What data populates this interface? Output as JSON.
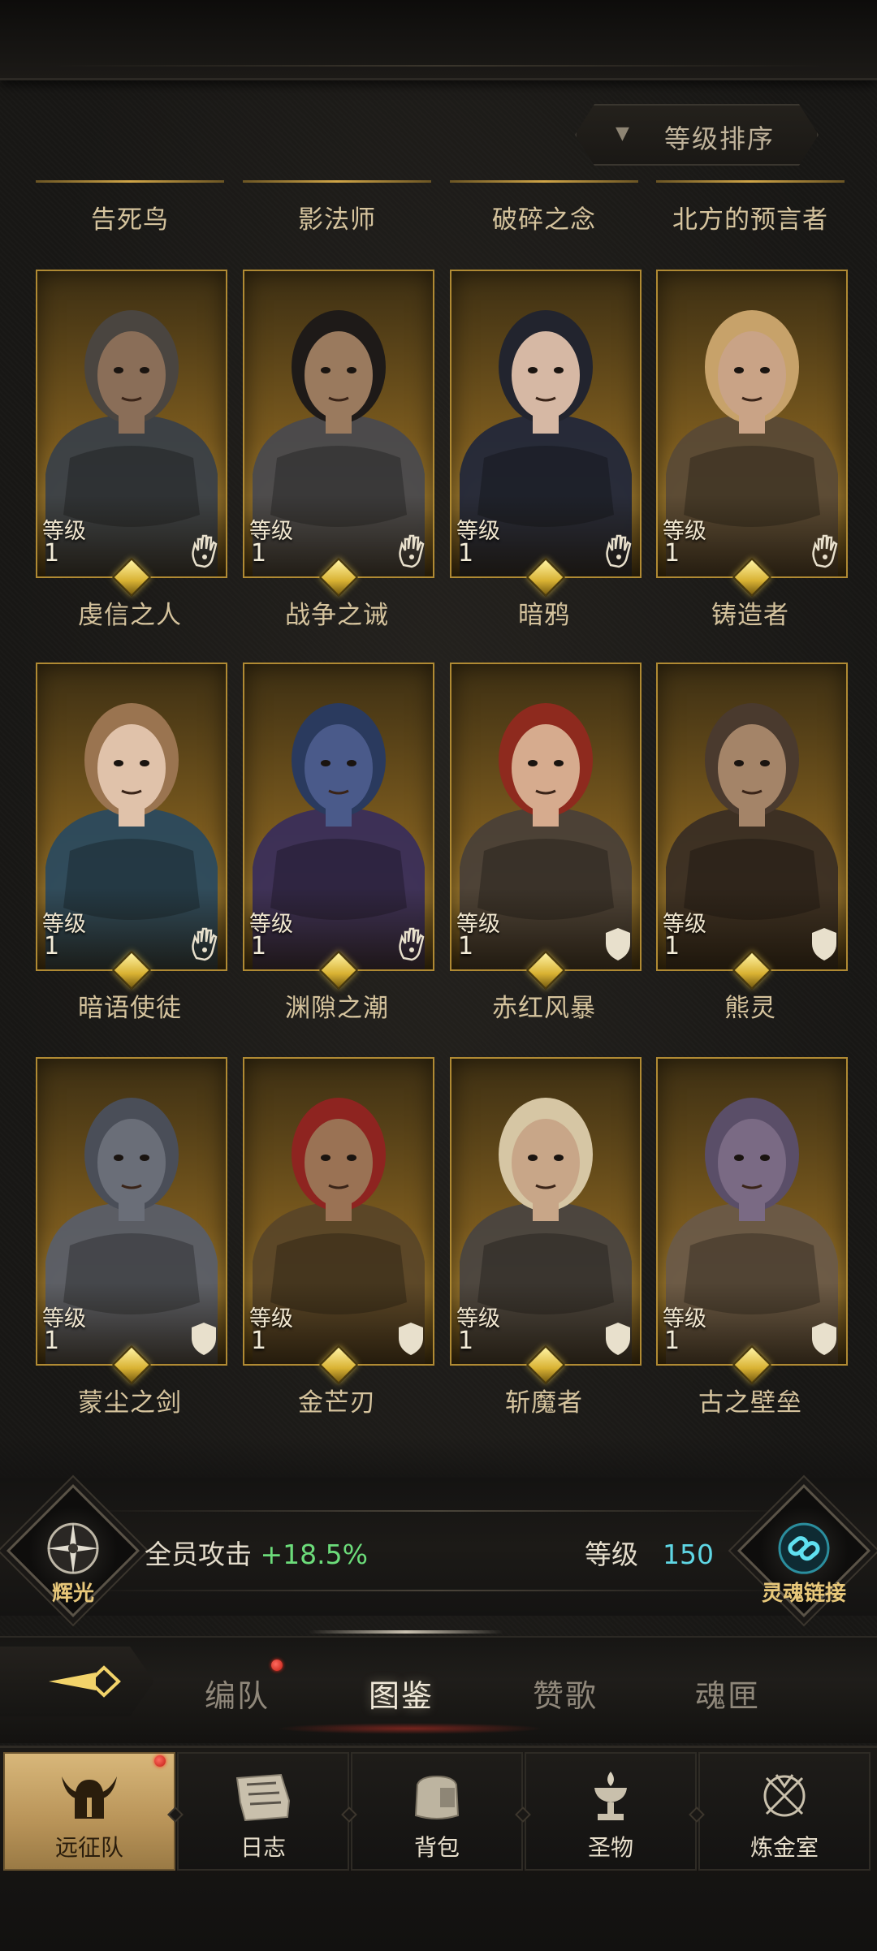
{
  "sort": {
    "label": "等级排序",
    "arrow_icon": "triangle-down-icon"
  },
  "top_row_names": [
    "告死鸟",
    "影法师",
    "破碎之念",
    "北方的预言者"
  ],
  "level_label": "等级",
  "heroes": [
    {
      "name": "虔信之人",
      "level": "1",
      "class_icon": "hand-icon",
      "palette": {
        "skin": "#8a6e58",
        "hair": "#4a4540",
        "armor": "#3a4048"
      }
    },
    {
      "name": "战争之诫",
      "level": "1",
      "class_icon": "hand-icon",
      "palette": {
        "skin": "#9a7a5e",
        "hair": "#1e1a18",
        "armor": "#4a4a4e"
      }
    },
    {
      "name": "暗鸦",
      "level": "1",
      "class_icon": "hand-icon",
      "palette": {
        "skin": "#d6b8a4",
        "hair": "#22242e",
        "armor": "#23283a"
      }
    },
    {
      "name": "铸造者",
      "level": "1",
      "class_icon": "hand-icon",
      "palette": {
        "skin": "#c9a386",
        "hair": "#c7a26a",
        "armor": "#5a4a36"
      }
    },
    {
      "name": "暗语使徒",
      "level": "1",
      "class_icon": "hand-icon",
      "palette": {
        "skin": "#e0c2aa",
        "hair": "#9a7450",
        "armor": "#2b4a5e"
      }
    },
    {
      "name": "渊隙之潮",
      "level": "1",
      "class_icon": "hand-icon",
      "palette": {
        "skin": "#4a5a8a",
        "hair": "#2a3a5e",
        "armor": "#3a2e5a"
      }
    },
    {
      "name": "赤红风暴",
      "level": "1",
      "class_icon": "shield-icon",
      "palette": {
        "skin": "#d6ab8e",
        "hair": "#8e2a1e",
        "armor": "#4a4038"
      }
    },
    {
      "name": "熊灵",
      "level": "1",
      "class_icon": "shield-icon",
      "palette": {
        "skin": "#a48468",
        "hair": "#4a3a2e",
        "armor": "#3a2e24"
      }
    },
    {
      "name": "蒙尘之剑",
      "level": "1",
      "class_icon": "shield-icon",
      "palette": {
        "skin": "#6a6e78",
        "hair": "#4a4e58",
        "armor": "#5a5e68"
      }
    },
    {
      "name": "金芒刃",
      "level": "1",
      "class_icon": "shield-icon",
      "palette": {
        "skin": "#9a7254",
        "hair": "#8e2420",
        "armor": "#5a4628"
      }
    },
    {
      "name": "斩魔者",
      "level": "1",
      "class_icon": "shield-icon",
      "palette": {
        "skin": "#c8a688",
        "hair": "#d6c6a4",
        "armor": "#4a4440"
      }
    },
    {
      "name": "古之壁垒",
      "level": "1",
      "class_icon": "shield-icon",
      "palette": {
        "skin": "#7a6a84",
        "hair": "#5a4e68",
        "armor": "#6a5a48"
      }
    }
  ],
  "status": {
    "radiance_label": "辉光",
    "radiance_icon": "compass-emblem-icon",
    "attack_label": "全员攻击",
    "attack_value": "+18.5%",
    "level_label": "等级",
    "level_value": "150",
    "soul_link_label": "灵魂链接",
    "soul_link_icon": "chain-link-icon",
    "colors": {
      "attack": "#6cdc7a",
      "level": "#5fd6e4",
      "gold": "#e8c87a"
    }
  },
  "tabs": [
    {
      "label": "编队",
      "active": false,
      "badge": true
    },
    {
      "label": "图鉴",
      "active": true,
      "badge": false
    },
    {
      "label": "赞歌",
      "active": false,
      "badge": false
    },
    {
      "label": "魂匣",
      "active": false,
      "badge": false
    }
  ],
  "nav": [
    {
      "label": "远征队",
      "icon": "horned-helmet-icon",
      "active": true,
      "badge": true
    },
    {
      "label": "日志",
      "icon": "scroll-icon",
      "active": false,
      "badge": true
    },
    {
      "label": "背包",
      "icon": "bag-icon",
      "active": false,
      "badge": true
    },
    {
      "label": "圣物",
      "icon": "chalice-icon",
      "active": false,
      "badge": true
    },
    {
      "label": "炼金室",
      "icon": "alchemy-icon",
      "active": false,
      "badge": false
    }
  ]
}
